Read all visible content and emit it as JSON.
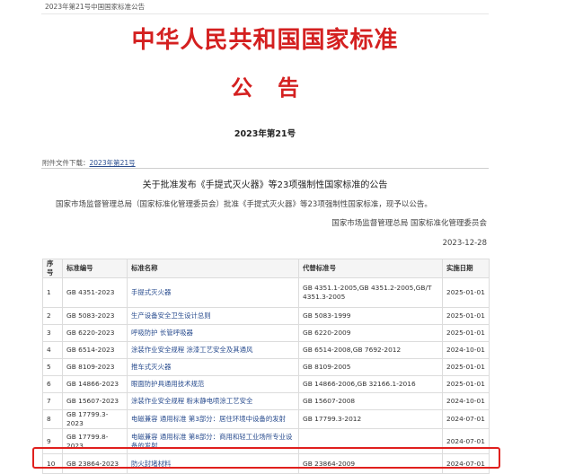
{
  "breadcrumb": "2023年第21号中国国家标准公告",
  "header": {
    "main_title": "中华人民共和国国家标准",
    "sub_title": "公告",
    "doc_number": "2023年第21号"
  },
  "attachment": {
    "label": "附件文件下载：",
    "link_text": "2023年第21号"
  },
  "notice": {
    "title": "关于批准发布《手提式灭火器》等23项强制性国家标准的公告",
    "body": "国家市场监督管理总局（国家标准化管理委员会）批准《手提式灭火器》等23项强制性国家标准，现予以公告。",
    "issuer": "国家市场监督管理总局 国家标准化管理委员会",
    "date": "2023-12-28"
  },
  "table": {
    "headers": [
      "序号",
      "标准编号",
      "标准名称",
      "代替标准号",
      "实施日期"
    ],
    "rows": [
      {
        "no": "1",
        "code": "GB 4351-2023",
        "name": "手提式灭火器",
        "replaces": "GB 4351.1-2005,GB 4351.2-2005,GB/T 4351.3-2005",
        "date": "2025-01-01"
      },
      {
        "no": "2",
        "code": "GB 5083-2023",
        "name": "生产设备安全卫生设计总则",
        "replaces": "GB 5083-1999",
        "date": "2025-01-01"
      },
      {
        "no": "3",
        "code": "GB 6220-2023",
        "name": "呼吸防护 长管呼吸器",
        "replaces": "GB 6220-2009",
        "date": "2025-01-01"
      },
      {
        "no": "4",
        "code": "GB 6514-2023",
        "name": "涂装作业安全规程 涂漆工艺安全及其通风",
        "replaces": "GB 6514-2008,GB 7692-2012",
        "date": "2024-10-01"
      },
      {
        "no": "5",
        "code": "GB 8109-2023",
        "name": "推车式灭火器",
        "replaces": "GB 8109-2005",
        "date": "2025-01-01"
      },
      {
        "no": "6",
        "code": "GB 14866-2023",
        "name": "眼面防护具通用技术规范",
        "replaces": "GB 14866-2006,GB 32166.1-2016",
        "date": "2025-01-01"
      },
      {
        "no": "7",
        "code": "GB 15607-2023",
        "name": "涂装作业安全规程 粉末静电喷涂工艺安全",
        "replaces": "GB 15607-2008",
        "date": "2024-10-01"
      },
      {
        "no": "8",
        "code": "GB 17799.3-2023",
        "name": "电磁兼容 通用标准 第3部分：居住环境中设备的发射",
        "replaces": "GB 17799.3-2012",
        "date": "2024-07-01"
      },
      {
        "no": "9",
        "code": "GB 17799.8-2023",
        "name": "电磁兼容 通用标准 第8部分：商用和轻工业场所专业设备的发射",
        "replaces": "",
        "date": "2024-07-01"
      },
      {
        "no": "10",
        "code": "GB 23864-2023",
        "name": "防火封堵材料",
        "replaces": "GB 23864-2009",
        "date": "2024-07-01"
      }
    ]
  },
  "highlight": {
    "color": "#e0201e",
    "row": "10"
  },
  "colors": {
    "title_red": "#d42020",
    "link_blue": "#2a4d8f"
  }
}
